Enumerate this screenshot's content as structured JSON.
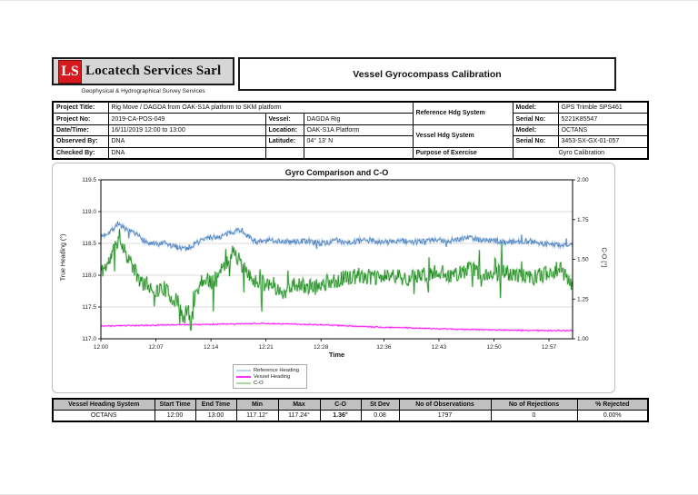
{
  "header": {
    "logo_initials": "LS",
    "logo_name": "Locatech Services Sarl",
    "logo_tagline": "Geophysical & Hydrographical Survey Services",
    "doc_title": "Vessel Gyrocompass Calibration",
    "logo_red": "#d6191f"
  },
  "info_table": {
    "project_title_label": "Project Title:",
    "project_title": "Rig Move / DAGDA from OAK-S1A platform to SKM platform",
    "project_no_label": "Project No:",
    "project_no": "2019-CA-POS-049",
    "date_time_label": "Date/Time:",
    "date_time": "16/11/2019 12:00 to 13:00",
    "observed_by_label": "Observed By:",
    "observed_by": "DNA",
    "checked_by_label": "Checked By:",
    "checked_by": "DNA",
    "vessel_label": "Vessel:",
    "vessel": "DAGDA Rig",
    "location_label": "Location:",
    "location": "OAK-S1A Platform",
    "latitude_label": "Latitude:",
    "latitude": "04° 13' N",
    "ref_hdg_label": "Reference Hdg System",
    "vessel_hdg_label": "Vessel Hdg System",
    "purpose_label": "Purpose of Exercise",
    "purpose": "Gyro Calibration",
    "model_label": "Model:",
    "serial_label": "Serial No:",
    "ref_model": "GPS Trimble SPS461",
    "ref_serial": "5221K85547",
    "vessel_model": "OCTANS",
    "vessel_serial": "3453-SX-GX-01-057"
  },
  "chart_data": {
    "type": "line",
    "title": "Gyro Comparison and C-O",
    "xlabel": "Time",
    "ylabel_left": "True Heading (°)",
    "ylabel_right": "C-O (°)",
    "x_range_minutes": [
      0,
      60
    ],
    "x_ticks": [
      "12:00",
      "12:07",
      "12:14",
      "12:21",
      "12:28",
      "12:36",
      "12:43",
      "12:50",
      "12:57"
    ],
    "x_tick_minutes": [
      0,
      7,
      14,
      21,
      28,
      36,
      43,
      50,
      57
    ],
    "ylim_left": [
      117.0,
      119.5
    ],
    "yticks_left": [
      "117.0",
      "117.5",
      "118.0",
      "118.5",
      "119.0",
      "119.5"
    ],
    "ylim_right": [
      1.0,
      2.0
    ],
    "yticks_right": [
      "1.00",
      "1.25",
      "1.50",
      "1.75",
      "2.00"
    ],
    "grid": "horizontal",
    "legend_position": "below",
    "samples": 760,
    "series": [
      {
        "name": "Reference Heading",
        "axis": "left",
        "color": "#4a7ebb",
        "halo": "#a9c7e7",
        "legend_color": "#b9d4ec",
        "noise": 0.045,
        "spike_prob": 0.02,
        "spike_scale": 2.0,
        "seed": 7,
        "anchors": [
          [
            0,
            118.6
          ],
          [
            1.5,
            118.72
          ],
          [
            2.2,
            118.82
          ],
          [
            3,
            118.72
          ],
          [
            4,
            118.66
          ],
          [
            5,
            118.6
          ],
          [
            6,
            118.5
          ],
          [
            7,
            118.48
          ],
          [
            8,
            118.5
          ],
          [
            9,
            118.46
          ],
          [
            10,
            118.44
          ],
          [
            11,
            118.42
          ],
          [
            12,
            118.5
          ],
          [
            13,
            118.56
          ],
          [
            14,
            118.6
          ],
          [
            15,
            118.6
          ],
          [
            16,
            118.64
          ],
          [
            17,
            118.7
          ],
          [
            17.8,
            118.72
          ],
          [
            19,
            118.58
          ],
          [
            20,
            118.52
          ],
          [
            22,
            118.55
          ],
          [
            24,
            118.52
          ],
          [
            26,
            118.54
          ],
          [
            28,
            118.5
          ],
          [
            30,
            118.54
          ],
          [
            32,
            118.52
          ],
          [
            34,
            118.55
          ],
          [
            36,
            118.52
          ],
          [
            38,
            118.54
          ],
          [
            40,
            118.52
          ],
          [
            42,
            118.55
          ],
          [
            44,
            118.54
          ],
          [
            46,
            118.58
          ],
          [
            47,
            118.6
          ],
          [
            48,
            118.56
          ],
          [
            50,
            118.54
          ],
          [
            52,
            118.52
          ],
          [
            54,
            118.54
          ],
          [
            56,
            118.5
          ],
          [
            58,
            118.48
          ],
          [
            60,
            118.47
          ]
        ]
      },
      {
        "name": "Vessel Heading",
        "axis": "left",
        "color": "#f400f4",
        "halo": "#ff9bff",
        "legend_color": "#ff33ff",
        "noise": 0.008,
        "spike_prob": 0.0,
        "spike_scale": 0,
        "seed": 3,
        "anchors": [
          [
            0,
            117.2
          ],
          [
            5,
            117.21
          ],
          [
            10,
            117.22
          ],
          [
            15,
            117.23
          ],
          [
            20,
            117.24
          ],
          [
            25,
            117.23
          ],
          [
            28,
            117.22
          ],
          [
            32,
            117.2
          ],
          [
            36,
            117.18
          ],
          [
            40,
            117.17
          ],
          [
            45,
            117.15
          ],
          [
            50,
            117.14
          ],
          [
            55,
            117.13
          ],
          [
            60,
            117.13
          ]
        ]
      },
      {
        "name": "C-O",
        "axis": "right",
        "color": "#1f8a1f",
        "halo": "#90cc90",
        "legend_color": "#a8d8a8",
        "noise": 0.05,
        "spike_prob": 0.05,
        "spike_scale": 3.2,
        "seed": 11,
        "anchors": [
          [
            0,
            1.42
          ],
          [
            1,
            1.48
          ],
          [
            2.3,
            1.64
          ],
          [
            3,
            1.56
          ],
          [
            4,
            1.46
          ],
          [
            5,
            1.36
          ],
          [
            6,
            1.34
          ],
          [
            7,
            1.3
          ],
          [
            8,
            1.32
          ],
          [
            9,
            1.26
          ],
          [
            10,
            1.22
          ],
          [
            10.5,
            1.1
          ],
          [
            11,
            1.2
          ],
          [
            11.5,
            1.08
          ],
          [
            12,
            1.28
          ],
          [
            13,
            1.38
          ],
          [
            14,
            1.36
          ],
          [
            15,
            1.4
          ],
          [
            16,
            1.48
          ],
          [
            17,
            1.56
          ],
          [
            18,
            1.44
          ],
          [
            19,
            1.38
          ],
          [
            20,
            1.36
          ],
          [
            21,
            1.36
          ],
          [
            22,
            1.34
          ],
          [
            23,
            1.28
          ],
          [
            24,
            1.33
          ],
          [
            25,
            1.34
          ],
          [
            27,
            1.32
          ],
          [
            29,
            1.36
          ],
          [
            31,
            1.38
          ],
          [
            33,
            1.4
          ],
          [
            35,
            1.38
          ],
          [
            37,
            1.4
          ],
          [
            39,
            1.38
          ],
          [
            41,
            1.4
          ],
          [
            43,
            1.42
          ],
          [
            45,
            1.4
          ],
          [
            47,
            1.44
          ],
          [
            49,
            1.4
          ],
          [
            51,
            1.42
          ],
          [
            53,
            1.4
          ],
          [
            55,
            1.38
          ],
          [
            57,
            1.42
          ],
          [
            58.5,
            1.44
          ],
          [
            60,
            1.34
          ]
        ]
      }
    ]
  },
  "stats_table": {
    "headers": [
      "Vessel Heading System",
      "Start Time",
      "End Time",
      "Min",
      "Max",
      "C-O",
      "St Dev",
      "No of Observations",
      "No of Rejections",
      "% Rejected"
    ],
    "bold_columns": [
      "C-O"
    ],
    "rows": [
      [
        "OCTANS",
        "12:00",
        "13:00",
        "117.12°",
        "117.24°",
        "1.36°",
        "0.08",
        "1797",
        "0",
        "0.00%"
      ]
    ]
  }
}
